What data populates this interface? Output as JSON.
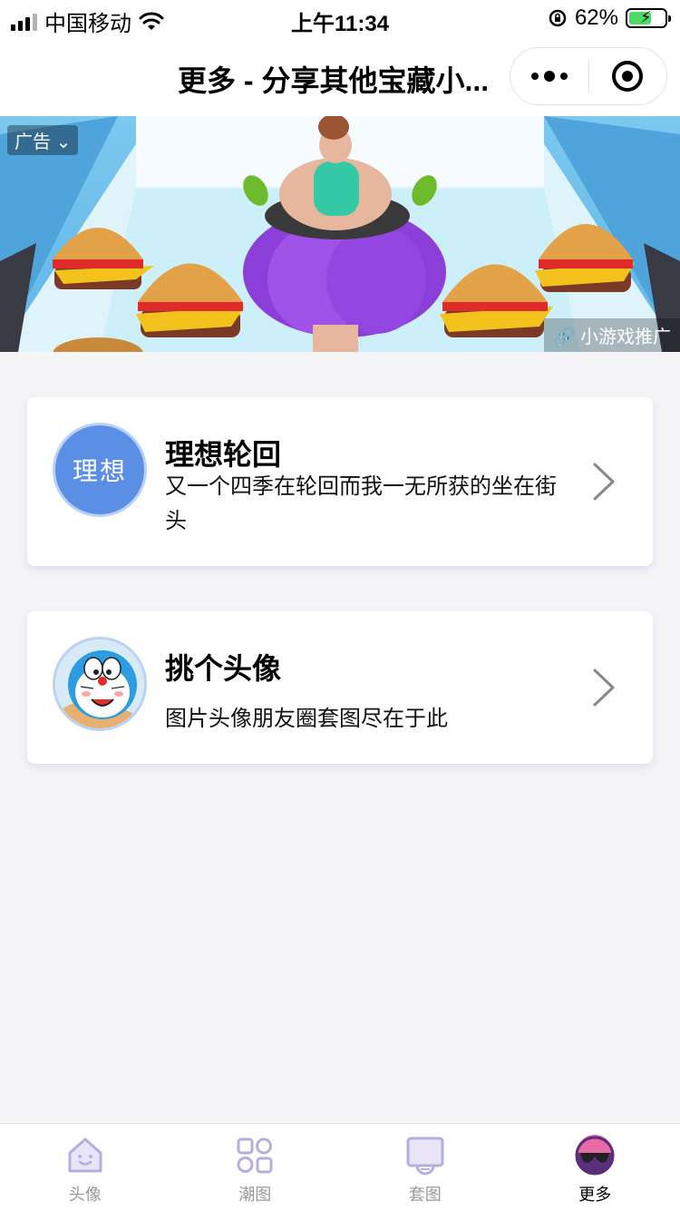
{
  "status_bar": {
    "carrier": "中国移动",
    "time": "上午11:34",
    "battery_percent": "62%",
    "battery_level": 0.62
  },
  "nav": {
    "title": "更多 - 分享其他宝藏小...",
    "more_icon": "more-dots-icon",
    "close_icon": "target-circle-icon"
  },
  "ad": {
    "tag": "广告",
    "source": "小游戏推广"
  },
  "cards": [
    {
      "title": "理想轮回",
      "description": "又一个四季在轮回而我一无所获的坐在街头",
      "avatar_text": "理想"
    },
    {
      "title": "挑个头像",
      "description": "图片头像朋友圈套图尽在于此"
    }
  ],
  "tabs": [
    {
      "label": "头像",
      "icon": "house-face-icon"
    },
    {
      "label": "潮图",
      "icon": "grid-icon"
    },
    {
      "label": "套图",
      "icon": "tv-icon"
    },
    {
      "label": "更多",
      "icon": "sunglasses-icon"
    }
  ],
  "colors": {
    "accent": "#5b8fe6",
    "tab_icon": "#b7aee0",
    "active_icon": "#e86aa8"
  }
}
